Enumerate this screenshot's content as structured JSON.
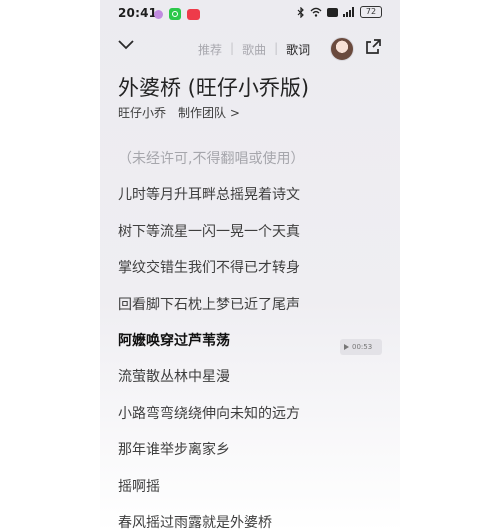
{
  "status_bar": {
    "time": "20:41",
    "battery": "72"
  },
  "header": {
    "tabs": [
      {
        "label": "推荐"
      },
      {
        "label": "歌曲"
      },
      {
        "label": "歌词"
      }
    ],
    "active_tab": "歌词"
  },
  "song": {
    "title": "外婆桥 (旺仔小乔版)",
    "artist": "旺仔小乔",
    "credits_link": "制作团队 >"
  },
  "lyrics": [
    "（未经许可,不得翻唱或使用）",
    "儿时等月升耳畔总摇晃着诗文",
    "树下等流星一闪一晃一个天真",
    "掌纹交错生我们不得已才转身",
    "回看脚下石枕上梦已近了尾声",
    "阿嬷唤穿过芦苇荡",
    "流萤散丛林中星漫",
    "小路弯弯绕绕伸向未知的远方",
    "那年谁举步离家乡",
    "摇啊摇",
    "春风摇过雨露就是外婆桥"
  ],
  "current_line_index": 5,
  "seek_tag": {
    "time": "00:53"
  },
  "colors": {
    "background_top": "#ecebf0",
    "text": "#3e3e3e",
    "muted": "#a6a6ac"
  }
}
